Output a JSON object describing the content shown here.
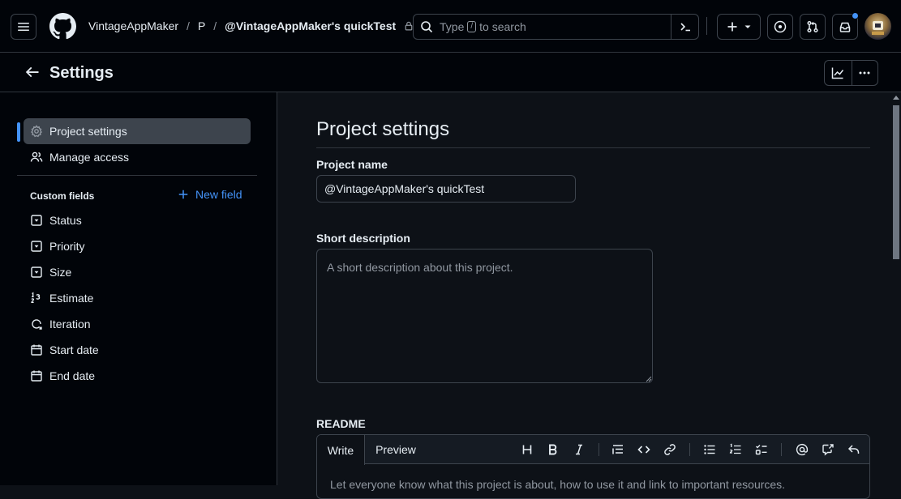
{
  "topbar": {
    "breadcrumb_owner": "VintageAppMaker",
    "breadcrumb_sep": "/",
    "breadcrumb_type": "P",
    "breadcrumb_project": "@VintageAppMaker's quickTest",
    "search_pre": "Type",
    "search_key": "/",
    "search_post": "to search",
    "icons": [
      "hamburger-icon",
      "github-logo-icon",
      "lock-icon",
      "search-icon",
      "command-palette-icon",
      "plus-icon",
      "triangle-down-icon",
      "issue-opened-icon",
      "git-pull-request-icon",
      "inbox-icon"
    ]
  },
  "settings_bar": {
    "title": "Settings",
    "icons": [
      "arrow-left-icon",
      "graph-icon",
      "kebab-horizontal-icon"
    ]
  },
  "sidebar": {
    "project_settings": "Project settings",
    "manage_access": "Manage access",
    "custom_fields_heading": "Custom fields",
    "new_field": "New field",
    "fields": [
      {
        "label": "Status",
        "icon": "single-select-icon"
      },
      {
        "label": "Priority",
        "icon": "single-select-icon"
      },
      {
        "label": "Size",
        "icon": "single-select-icon"
      },
      {
        "label": "Estimate",
        "icon": "number-icon"
      },
      {
        "label": "Iteration",
        "icon": "iterations-icon"
      },
      {
        "label": "Start date",
        "icon": "calendar-icon"
      },
      {
        "label": "End date",
        "icon": "calendar-icon"
      }
    ]
  },
  "main": {
    "title": "Project settings",
    "project_name_label": "Project name",
    "project_name_value": "@VintageAppMaker's quickTest",
    "short_desc_label": "Short description",
    "short_desc_placeholder": "A short description about this project.",
    "readme_label": "README",
    "tab_write": "Write",
    "tab_preview": "Preview",
    "toolbar_icons": [
      "heading-icon",
      "bold-icon",
      "italic-icon",
      "quote-icon",
      "code-icon",
      "link-icon",
      "unordered-list-icon",
      "ordered-list-icon",
      "tasklist-icon",
      "mention-icon",
      "cross-reference-icon",
      "reply-icon"
    ],
    "readme_placeholder": "Let everyone know what this project is about, how to use it and link to important resources."
  },
  "colors": {
    "background": "#0d1117",
    "header_background": "#010409",
    "border": "#3d444d",
    "accent": "#4493f8",
    "text": "#e6edf3",
    "muted": "#9198a1"
  }
}
